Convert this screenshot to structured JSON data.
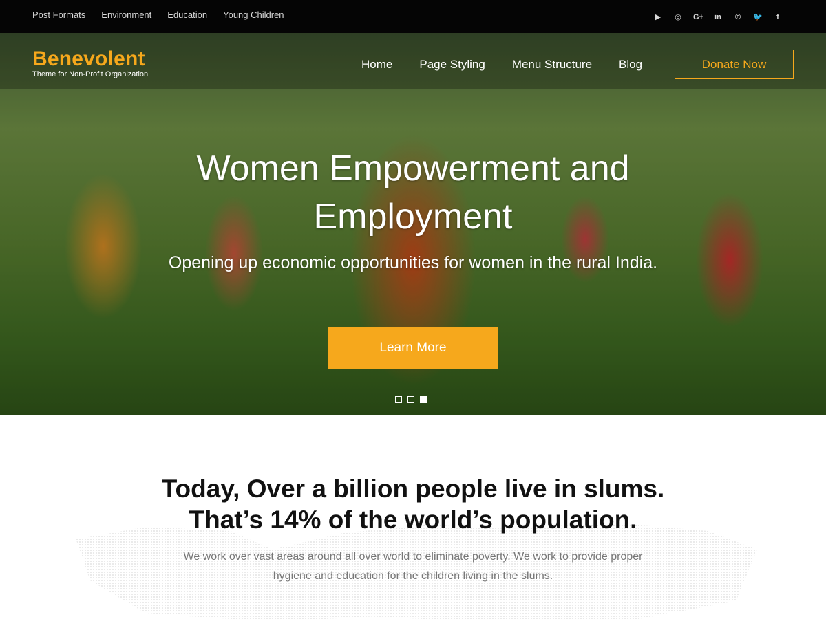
{
  "topbar": {
    "links": [
      "Post Formats",
      "Environment",
      "Education",
      "Young Children"
    ],
    "social": [
      {
        "icon": "youtube-icon",
        "glyph": "▶"
      },
      {
        "icon": "instagram-icon",
        "glyph": "◎"
      },
      {
        "icon": "google-plus-icon",
        "glyph": "G+"
      },
      {
        "icon": "linkedin-icon",
        "glyph": "in"
      },
      {
        "icon": "pinterest-icon",
        "glyph": "℗"
      },
      {
        "icon": "twitter-icon",
        "glyph": "🐦"
      },
      {
        "icon": "facebook-icon",
        "glyph": "f"
      }
    ]
  },
  "header": {
    "logo_name": "Benevolent",
    "logo_tagline": "Theme for Non-Profit Organization",
    "nav": [
      "Home",
      "Page Styling",
      "Menu Structure",
      "Blog"
    ],
    "donate_label": "Donate Now"
  },
  "hero": {
    "title_line1": "Women Empowerment and",
    "title_line2": "Employment",
    "subtitle": "Opening up economic opportunities for women in the rural India.",
    "button_label": "Learn More",
    "slides": 3,
    "active_slide": 3
  },
  "intro": {
    "heading_line1": "Today, Over a billion people live in slums.",
    "heading_line2": "That’s 14% of the world’s population.",
    "body_line1": "We work over vast areas around all over world to eliminate poverty. We work to provide proper",
    "body_line2": "hygiene and education for the children living in the slums."
  },
  "colors": {
    "accent": "#f6a81c",
    "topbar": "#050505"
  }
}
